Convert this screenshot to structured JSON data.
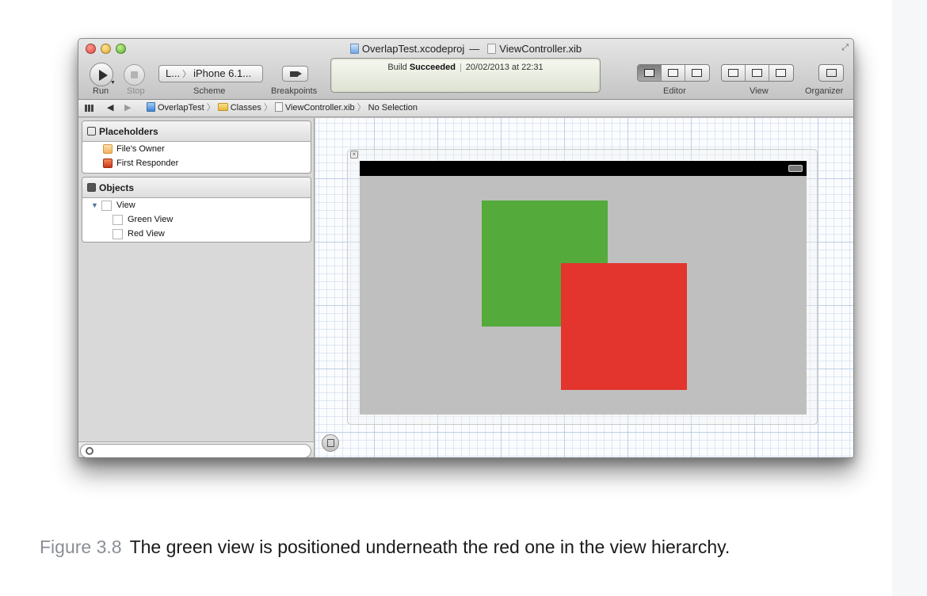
{
  "window": {
    "project_file": "OverlapTest.xcodeproj",
    "title_separator": "—",
    "document_file": "ViewController.xib"
  },
  "toolbar": {
    "scheme_target": "L...",
    "scheme_device": "iPhone 6.1...",
    "labels": {
      "run": "Run",
      "stop": "Stop",
      "scheme": "Scheme",
      "breakpoints": "Breakpoints",
      "editor": "Editor",
      "view": "View",
      "organizer": "Organizer"
    },
    "activity": {
      "status_prefix": "Build",
      "status": "Succeeded",
      "separator": "|",
      "timestamp": "20/02/2013 at 22:31"
    }
  },
  "jumpbar": {
    "back": "◀",
    "forward": "▶",
    "crumbs": [
      "OverlapTest",
      "Classes",
      "ViewController.xib",
      "No Selection"
    ]
  },
  "outline": {
    "placeholders": {
      "heading": "Placeholders",
      "items": [
        "File's Owner",
        "First Responder"
      ]
    },
    "objects": {
      "heading": "Objects",
      "root": "View",
      "children": [
        "Green View",
        "Red View"
      ]
    }
  },
  "canvas": {
    "colors": {
      "green_view": "#54ab3b",
      "red_view": "#e3342d",
      "background": "#bfbfbf"
    }
  },
  "caption": {
    "figure_label": "Figure 3.8",
    "text": "The green view is positioned underneath the red one in the view hierarchy."
  }
}
